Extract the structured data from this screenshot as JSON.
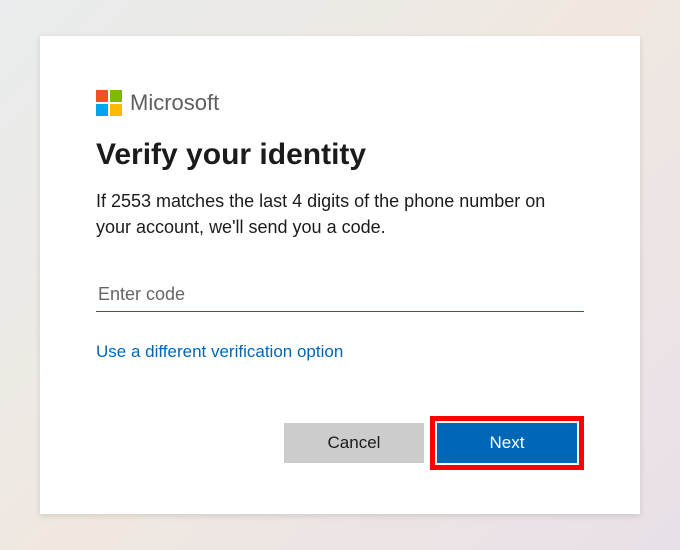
{
  "brand": {
    "name": "Microsoft",
    "logo_colors": [
      "#f25022",
      "#7fba00",
      "#00a4ef",
      "#ffb900"
    ]
  },
  "heading": "Verify your identity",
  "body_text": "If 2553 matches the last 4 digits of the phone number on your account, we'll send you a code.",
  "code_input": {
    "placeholder": "Enter code",
    "value": ""
  },
  "alt_option_link": "Use a different verification option",
  "buttons": {
    "cancel": "Cancel",
    "next": "Next"
  },
  "colors": {
    "accent": "#0067b8",
    "highlight_ring": "#ff0000"
  }
}
